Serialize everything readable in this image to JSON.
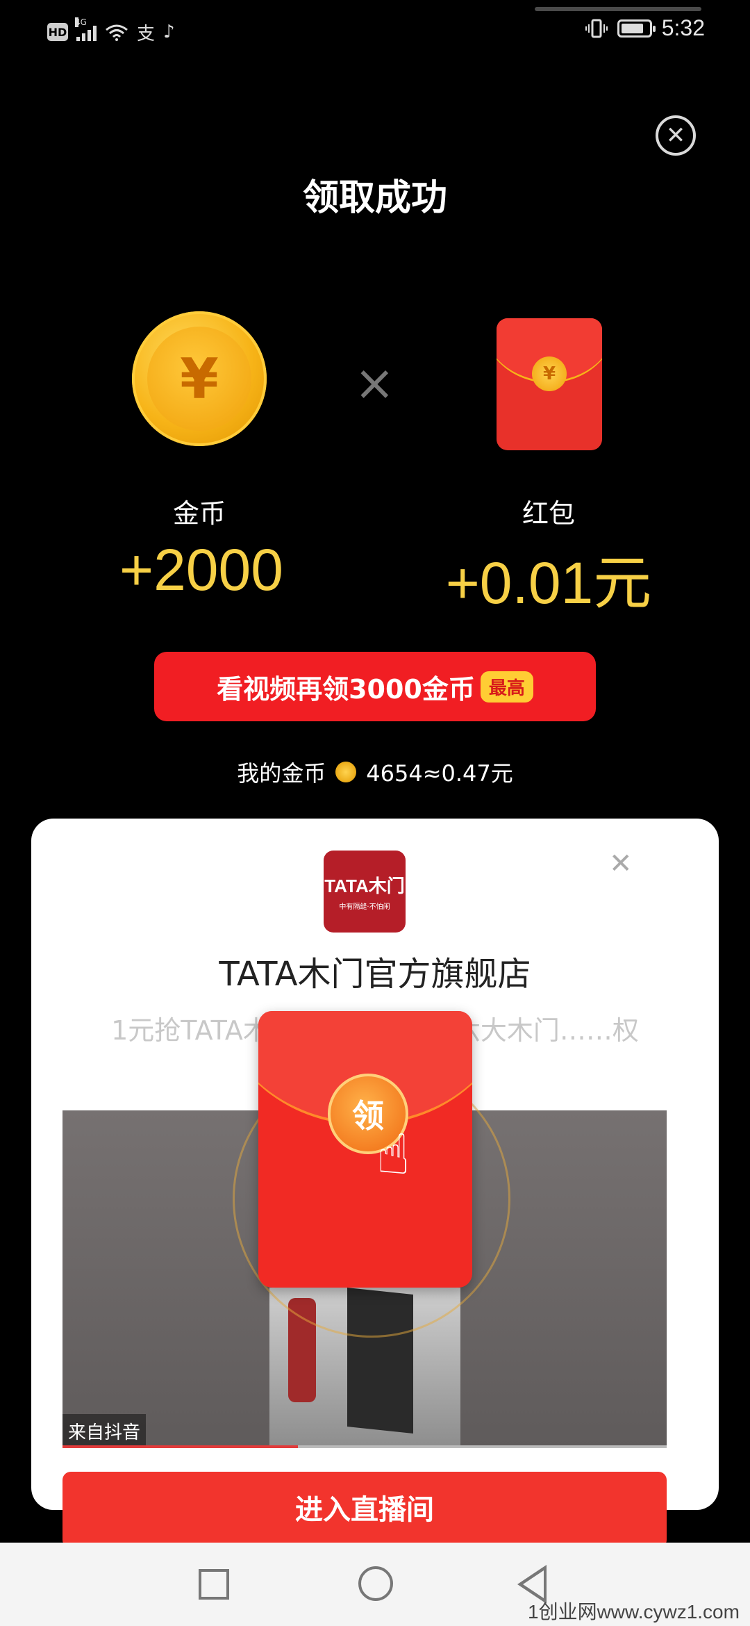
{
  "status_bar": {
    "hd": "HD",
    "network": "4G",
    "alipay_glyph": "支",
    "tiktok_glyph": "♪",
    "time": "5:32"
  },
  "header": {
    "title": "领取成功"
  },
  "rewards": {
    "coin": {
      "label": "金币",
      "amount": "+2000",
      "symbol": "¥"
    },
    "separator": "×",
    "red_packet": {
      "label": "红包",
      "amount": "+0.01元",
      "symbol": "¥"
    }
  },
  "cta": {
    "label": "看视频再领3000金币",
    "badge": "最高"
  },
  "my_coins": {
    "label": "我的金币",
    "value": "4654≈0.47元"
  },
  "ad": {
    "logo_text": "TATA木门",
    "logo_tagline": "中有隔缝·不怕闹",
    "store_name": "TATA木门官方旗舰店",
    "description": "1元抢TATA木门……直播间享六大木门……权",
    "video_source": "来自抖音",
    "video_progress": 0.39,
    "envelope_label": "领",
    "enter_button": "进入直播间"
  },
  "watermark": "1创业网www.cywz1.com",
  "colors": {
    "accent_red": "#f11e23",
    "gold": "#f7d046",
    "badge_yellow": "#ffcd34"
  }
}
